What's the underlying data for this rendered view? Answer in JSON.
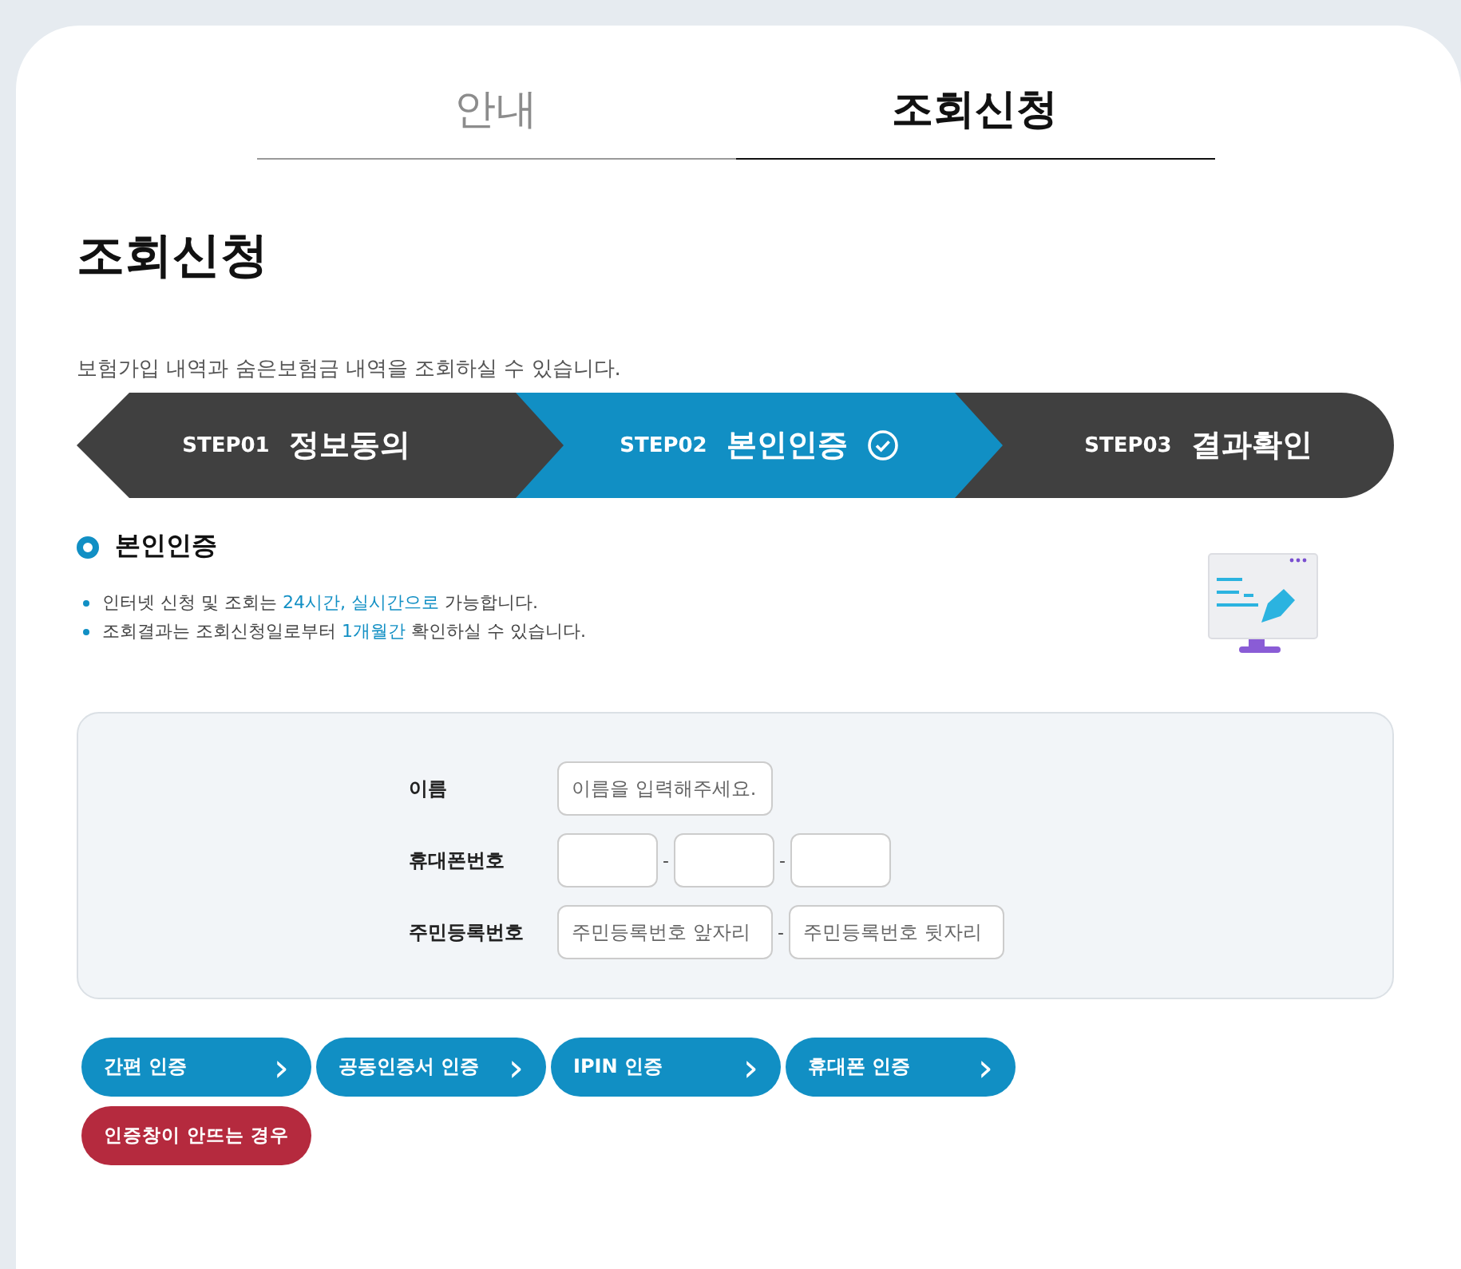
{
  "tabs": [
    {
      "label": "안내",
      "selected": false
    },
    {
      "label": "조회신청",
      "selected": true
    }
  ],
  "page_title": "조회신청",
  "description": "보험가입 내역과 숨은보험금 내역을 조회하실 수 있습니다.",
  "steps": [
    {
      "number": "STEP01",
      "label": "정보동의",
      "selected": false
    },
    {
      "number": "STEP02",
      "label": "본인인증",
      "selected": true
    },
    {
      "number": "STEP03",
      "label": "결과확인",
      "selected": false
    }
  ],
  "section_title": "본인인증",
  "notes": [
    "인터넷 신청 및 조회는 **24시간, 실시간으로** 가능합니다.",
    "조회결과는 조회신청일로부터 **1개월간** 확인하실 수 있습니다."
  ],
  "form": [
    {
      "label": "이름",
      "fields": [
        {
          "placeholder": "이름을 입력해주세요."
        }
      ]
    },
    {
      "label": "휴대폰번호",
      "fields": [
        {
          "kind": "short"
        },
        {
          "kind": "short"
        },
        {
          "kind": "short"
        }
      ],
      "separator": "-"
    },
    {
      "label": "주민등록번호",
      "fields": [
        {
          "placeholder": "주민등록번호 앞자리"
        },
        {
          "placeholder": "주민등록번호 뒷자리"
        }
      ],
      "separator": "-"
    }
  ],
  "auth_buttons": [
    {
      "label": "간편 인증",
      "arrow": "›"
    },
    {
      "label": "공동인증서 인증",
      "arrow": "›"
    },
    {
      "label": "IPIN 인증",
      "arrow": "›"
    },
    {
      "label": "휴대폰 인증",
      "arrow": "›"
    }
  ],
  "help_button": "인증창이 안뜨는 경우"
}
